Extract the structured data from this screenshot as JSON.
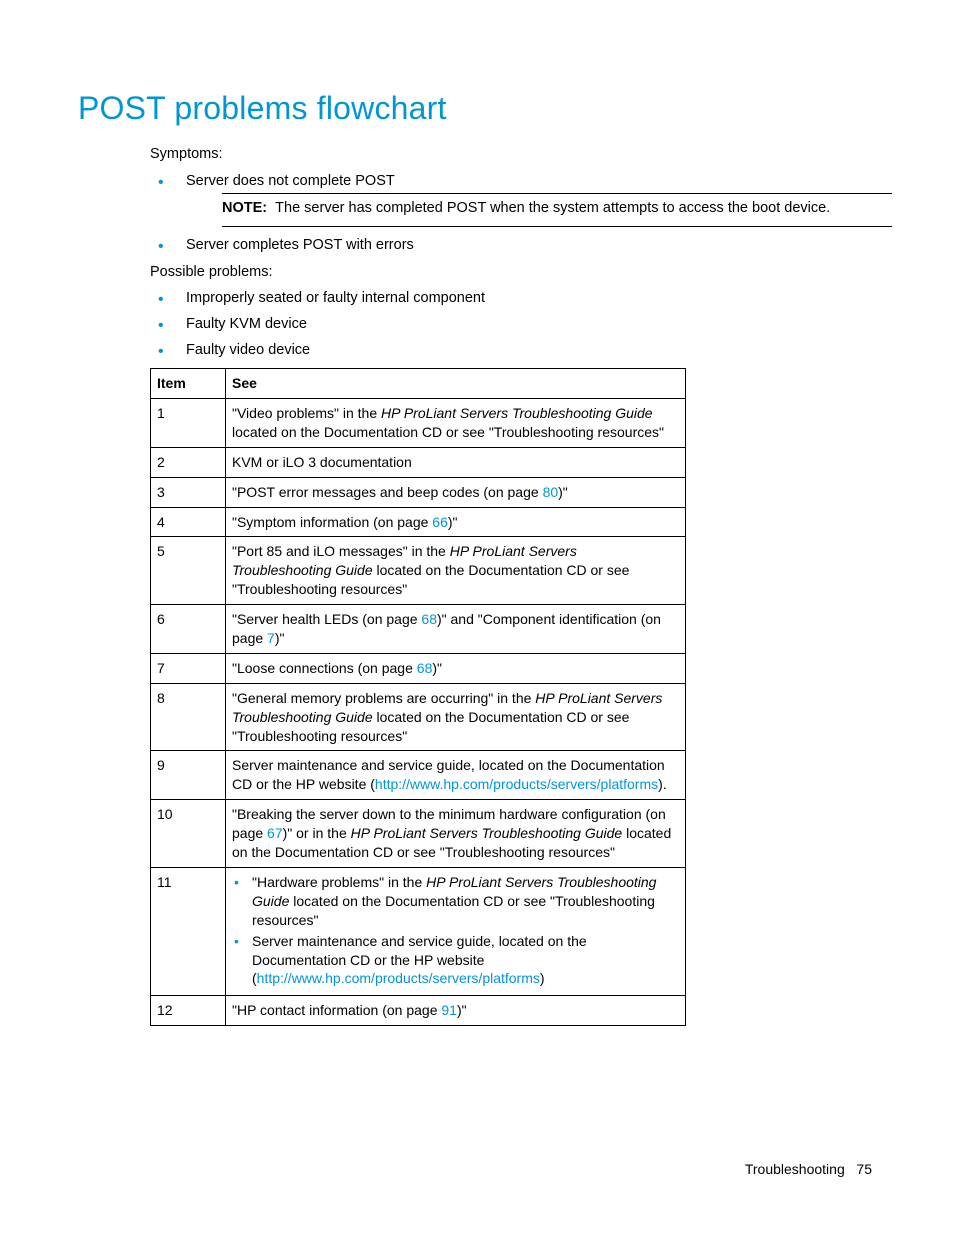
{
  "heading": "POST problems flowchart",
  "symptoms_label": "Symptoms:",
  "symptom_items": [
    "Server does not complete POST",
    "Server completes POST with errors"
  ],
  "note_label": "NOTE:",
  "note_text": "The server has completed POST when the system attempts to access the boot device.",
  "possible_label": "Possible problems:",
  "possible_items": [
    "Improperly seated or faulty internal component",
    "Faulty KVM device",
    "Faulty video device"
  ],
  "table": {
    "headers": {
      "item": "Item",
      "see": "See"
    },
    "rows": {
      "1": {
        "pre": "\"Video problems\" in the ",
        "ital": "HP ProLiant Servers Troubleshooting Guide",
        "post": " located on the Documentation CD or see \"Troubleshooting resources\""
      },
      "2": {
        "text": "KVM or iLO 3 documentation"
      },
      "3": {
        "pre": "\"POST error messages and beep codes (on page ",
        "link": "80",
        "post": ")\""
      },
      "4": {
        "pre": "\"Symptom information (on page ",
        "link": "66",
        "post": ")\""
      },
      "5": {
        "pre": "\"Port 85 and iLO messages\" in the ",
        "ital": "HP ProLiant Servers Troubleshooting Guide",
        "post": " located on the Documentation CD or see \"Troubleshooting resources\""
      },
      "6": {
        "pre": "\"Server health LEDs (on page ",
        "link1": "68",
        "mid": ")\" and \"Component identification (on page ",
        "link2": "7",
        "post": ")\""
      },
      "7": {
        "pre": "\"Loose connections (on page ",
        "link": "68",
        "post": ")\""
      },
      "8": {
        "pre": "\"General memory problems are occurring\" in the ",
        "ital": "HP ProLiant Servers Troubleshooting Guide",
        "post": " located on the Documentation CD or see \"Troubleshooting resources\""
      },
      "9": {
        "pre": "Server maintenance and service guide, located on the Documentation CD or the HP website (",
        "link": "http://www.hp.com/products/servers/platforms",
        "post": ")."
      },
      "10": {
        "pre": "\"Breaking the server down to the minimum hardware configuration (on page ",
        "link": "67",
        "mid": ")\" or in the ",
        "ital": "HP ProLiant Servers Troubleshooting Guide",
        "post": " located on the Documentation CD or see \"Troubleshooting resources\""
      },
      "11": {
        "a_pre": "\"Hardware problems\" in the ",
        "a_ital": "HP ProLiant Servers Troubleshooting Guide",
        "a_post": " located on the Documentation CD or see \"Troubleshooting resources\"",
        "b_pre": "Server maintenance and service guide, located on the Documentation CD or the HP website (",
        "b_link": "http://www.hp.com/products/servers/platforms",
        "b_post": ")"
      },
      "12": {
        "pre": "\"HP contact information (on page ",
        "link": "91",
        "post": ")\""
      }
    },
    "ids": [
      "1",
      "2",
      "3",
      "4",
      "5",
      "6",
      "7",
      "8",
      "9",
      "10",
      "11",
      "12"
    ]
  },
  "footer": {
    "section": "Troubleshooting",
    "page": "75"
  }
}
